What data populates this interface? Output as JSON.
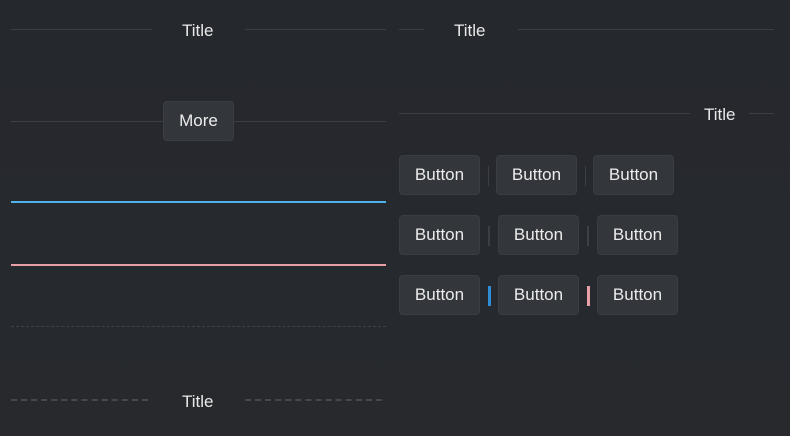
{
  "left": {
    "divider1_title": "Title",
    "more_label": "More",
    "divider_bottom_title": "Title"
  },
  "right": {
    "divider1_title": "Title",
    "divider2_title": "Title",
    "row1": [
      "Button",
      "Button",
      "Button"
    ],
    "row2": [
      "Button",
      "Button",
      "Button"
    ],
    "row3": [
      "Button",
      "Button",
      "Button"
    ]
  },
  "colors": {
    "accent_blue": "#4fb3e8",
    "accent_pink": "#e8a0a8",
    "separator_blue": "#2f8ed6",
    "background": "#26292d"
  }
}
